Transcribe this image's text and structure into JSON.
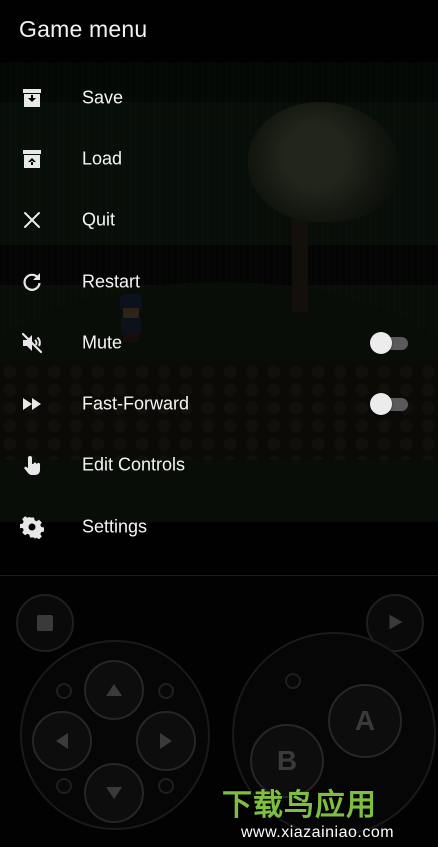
{
  "menu": {
    "title": "Game menu",
    "items": [
      {
        "label": "Save",
        "icon": "save-icon"
      },
      {
        "label": "Load",
        "icon": "load-icon"
      },
      {
        "label": "Quit",
        "icon": "close-icon"
      },
      {
        "label": "Restart",
        "icon": "restart-icon"
      },
      {
        "label": "Mute",
        "icon": "mute-icon",
        "toggle": false
      },
      {
        "label": "Fast-Forward",
        "icon": "fast-forward-icon",
        "toggle": false
      },
      {
        "label": "Edit Controls",
        "icon": "touch-icon"
      },
      {
        "label": "Settings",
        "icon": "gear-icon"
      }
    ]
  },
  "gamepad": {
    "a_label": "A",
    "b_label": "B",
    "icons": [
      "stop-icon",
      "play-icon",
      "arrow-up-icon",
      "arrow-down-icon",
      "arrow-left-icon",
      "arrow-right-icon"
    ]
  },
  "watermark": {
    "logo": "下载鸟应用",
    "url": "www.xiazainiao.com"
  },
  "colors": {
    "menu_text": "#f5f5f5",
    "toggle_off_thumb": "#ececec",
    "toggle_off_track": "#5a5a5a",
    "watermark_green": "#7fbf3f"
  }
}
